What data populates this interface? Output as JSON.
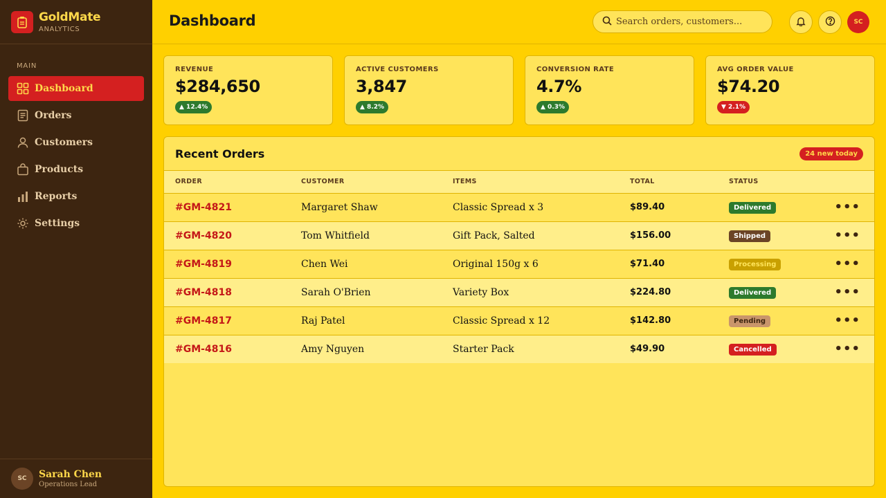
{
  "brand": {
    "name": "GoldMate",
    "sub": "ANALYTICS"
  },
  "sidebar": {
    "section": "MAIN",
    "items": [
      {
        "label": "Dashboard",
        "icon": "grid-icon",
        "active": true
      },
      {
        "label": "Orders",
        "icon": "document-icon"
      },
      {
        "label": "Customers",
        "icon": "user-icon"
      },
      {
        "label": "Products",
        "icon": "bag-icon"
      },
      {
        "label": "Reports",
        "icon": "bar-chart-icon"
      },
      {
        "label": "Settings",
        "icon": "gear-icon"
      }
    ],
    "user": {
      "initials": "SC",
      "name": "Sarah Chen",
      "role": "Operations Lead"
    }
  },
  "header": {
    "title": "Dashboard",
    "search_placeholder": "Search orders, customers...",
    "avatar": "SC"
  },
  "stats": [
    {
      "label": "REVENUE",
      "value": "$284,650",
      "change": "▲ 12.4%",
      "trend": "up"
    },
    {
      "label": "ACTIVE CUSTOMERS",
      "value": "3,847",
      "change": "▲ 8.2%",
      "trend": "up"
    },
    {
      "label": "CONVERSION RATE",
      "value": "4.7%",
      "change": "▲ 0.3%",
      "trend": "up"
    },
    {
      "label": "AVG ORDER VALUE",
      "value": "$74.20",
      "change": "▼ 2.1%",
      "trend": "down"
    }
  ],
  "orders": {
    "title": "Recent Orders",
    "badge": "24 new today",
    "columns": [
      "ORDER",
      "CUSTOMER",
      "ITEMS",
      "TOTAL",
      "STATUS"
    ],
    "rows": [
      {
        "id": "#GM-4821",
        "customer": "Margaret Shaw",
        "items": "Classic Spread x 3",
        "total": "$89.40",
        "status": "Delivered"
      },
      {
        "id": "#GM-4820",
        "customer": "Tom Whitfield",
        "items": "Gift Pack, Salted",
        "total": "$156.00",
        "status": "Shipped"
      },
      {
        "id": "#GM-4819",
        "customer": "Chen Wei",
        "items": "Original 150g x 6",
        "total": "$71.40",
        "status": "Processing"
      },
      {
        "id": "#GM-4818",
        "customer": "Sarah O'Brien",
        "items": "Variety Box",
        "total": "$224.80",
        "status": "Delivered"
      },
      {
        "id": "#GM-4817",
        "customer": "Raj Patel",
        "items": "Classic Spread x 12",
        "total": "$142.80",
        "status": "Pending"
      },
      {
        "id": "#GM-4816",
        "customer": "Amy Nguyen",
        "items": "Starter Pack",
        "total": "$49.90",
        "status": "Cancelled"
      }
    ],
    "more_label": "•••"
  },
  "colors": {
    "accent": "#D42020",
    "background": "#FFD000",
    "sidebar": "#3D2510",
    "success": "#2D7A2D"
  }
}
